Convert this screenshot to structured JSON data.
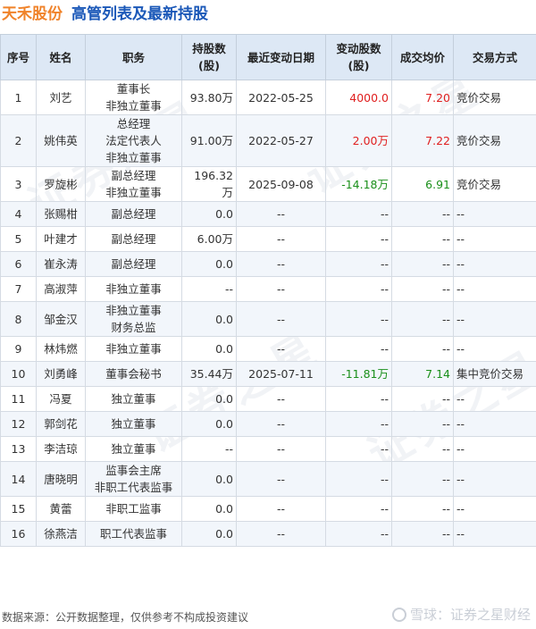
{
  "title": {
    "company": "天禾股份",
    "subtitle": "高管列表及最新持股"
  },
  "columns": [
    "序号",
    "姓名",
    "职务",
    "持股数\n(股)",
    "最近变动日期",
    "变动股数\n(股)",
    "成交均价",
    "交易方式"
  ],
  "rows": [
    {
      "no": "1",
      "name": "刘艺",
      "title": "董事长\n非独立董事",
      "shares": "93.80万",
      "date": "2022-05-25",
      "change": "4000.0",
      "price": "7.20",
      "method": "竞价交易",
      "dir": "up"
    },
    {
      "no": "2",
      "name": "姚伟英",
      "title": "总经理\n法定代表人\n非独立董事",
      "shares": "91.00万",
      "date": "2022-05-27",
      "change": "2.00万",
      "price": "7.22",
      "method": "竞价交易",
      "dir": "up"
    },
    {
      "no": "3",
      "name": "罗旋彬",
      "title": "副总经理\n非独立董事",
      "shares": "196.32万",
      "date": "2025-09-08",
      "change": "-14.18万",
      "price": "6.91",
      "method": "竞价交易",
      "dir": "down"
    },
    {
      "no": "4",
      "name": "张赐柑",
      "title": "副总经理",
      "shares": "0.0",
      "date": "--",
      "change": "--",
      "price": "--",
      "method": "--",
      "dir": "none"
    },
    {
      "no": "5",
      "name": "叶建才",
      "title": "副总经理",
      "shares": "6.00万",
      "date": "--",
      "change": "--",
      "price": "--",
      "method": "--",
      "dir": "none"
    },
    {
      "no": "6",
      "name": "崔永涛",
      "title": "副总经理",
      "shares": "0.0",
      "date": "--",
      "change": "--",
      "price": "--",
      "method": "--",
      "dir": "none"
    },
    {
      "no": "7",
      "name": "高淑萍",
      "title": "非独立董事",
      "shares": "--",
      "date": "--",
      "change": "--",
      "price": "--",
      "method": "--",
      "dir": "none"
    },
    {
      "no": "8",
      "name": "邹金汉",
      "title": "非独立董事\n财务总监",
      "shares": "0.0",
      "date": "--",
      "change": "--",
      "price": "--",
      "method": "--",
      "dir": "none"
    },
    {
      "no": "9",
      "name": "林炜燃",
      "title": "非独立董事",
      "shares": "0.0",
      "date": "--",
      "change": "--",
      "price": "--",
      "method": "--",
      "dir": "none"
    },
    {
      "no": "10",
      "name": "刘勇峰",
      "title": "董事会秘书",
      "shares": "35.44万",
      "date": "2025-07-11",
      "change": "-11.81万",
      "price": "7.14",
      "method": "集中竞价交易",
      "dir": "down"
    },
    {
      "no": "11",
      "name": "冯夏",
      "title": "独立董事",
      "shares": "0.0",
      "date": "--",
      "change": "--",
      "price": "--",
      "method": "--",
      "dir": "none"
    },
    {
      "no": "12",
      "name": "郭剑花",
      "title": "独立董事",
      "shares": "0.0",
      "date": "--",
      "change": "--",
      "price": "--",
      "method": "--",
      "dir": "none"
    },
    {
      "no": "13",
      "name": "李洁琼",
      "title": "独立董事",
      "shares": "--",
      "date": "--",
      "change": "--",
      "price": "--",
      "method": "--",
      "dir": "none"
    },
    {
      "no": "14",
      "name": "唐晓明",
      "title": "监事会主席\n非职工代表监事",
      "shares": "0.0",
      "date": "--",
      "change": "--",
      "price": "--",
      "method": "--",
      "dir": "none"
    },
    {
      "no": "15",
      "name": "黄蕾",
      "title": "非职工监事",
      "shares": "0.0",
      "date": "--",
      "change": "--",
      "price": "--",
      "method": "--",
      "dir": "none"
    },
    {
      "no": "16",
      "name": "徐燕洁",
      "title": "职工代表监事",
      "shares": "0.0",
      "date": "--",
      "change": "--",
      "price": "--",
      "method": "--",
      "dir": "none"
    }
  ],
  "footer": "数据来源：公开数据整理，仅供参考不构成投资建议",
  "brand": "雪球：证券之星财经",
  "watermark": "证券之星",
  "colors": {
    "company": "#f0832a",
    "subtitle": "#1b58b8",
    "up": "#e02020",
    "down": "#1a8f1a",
    "header_bg": "#dde8f5"
  }
}
